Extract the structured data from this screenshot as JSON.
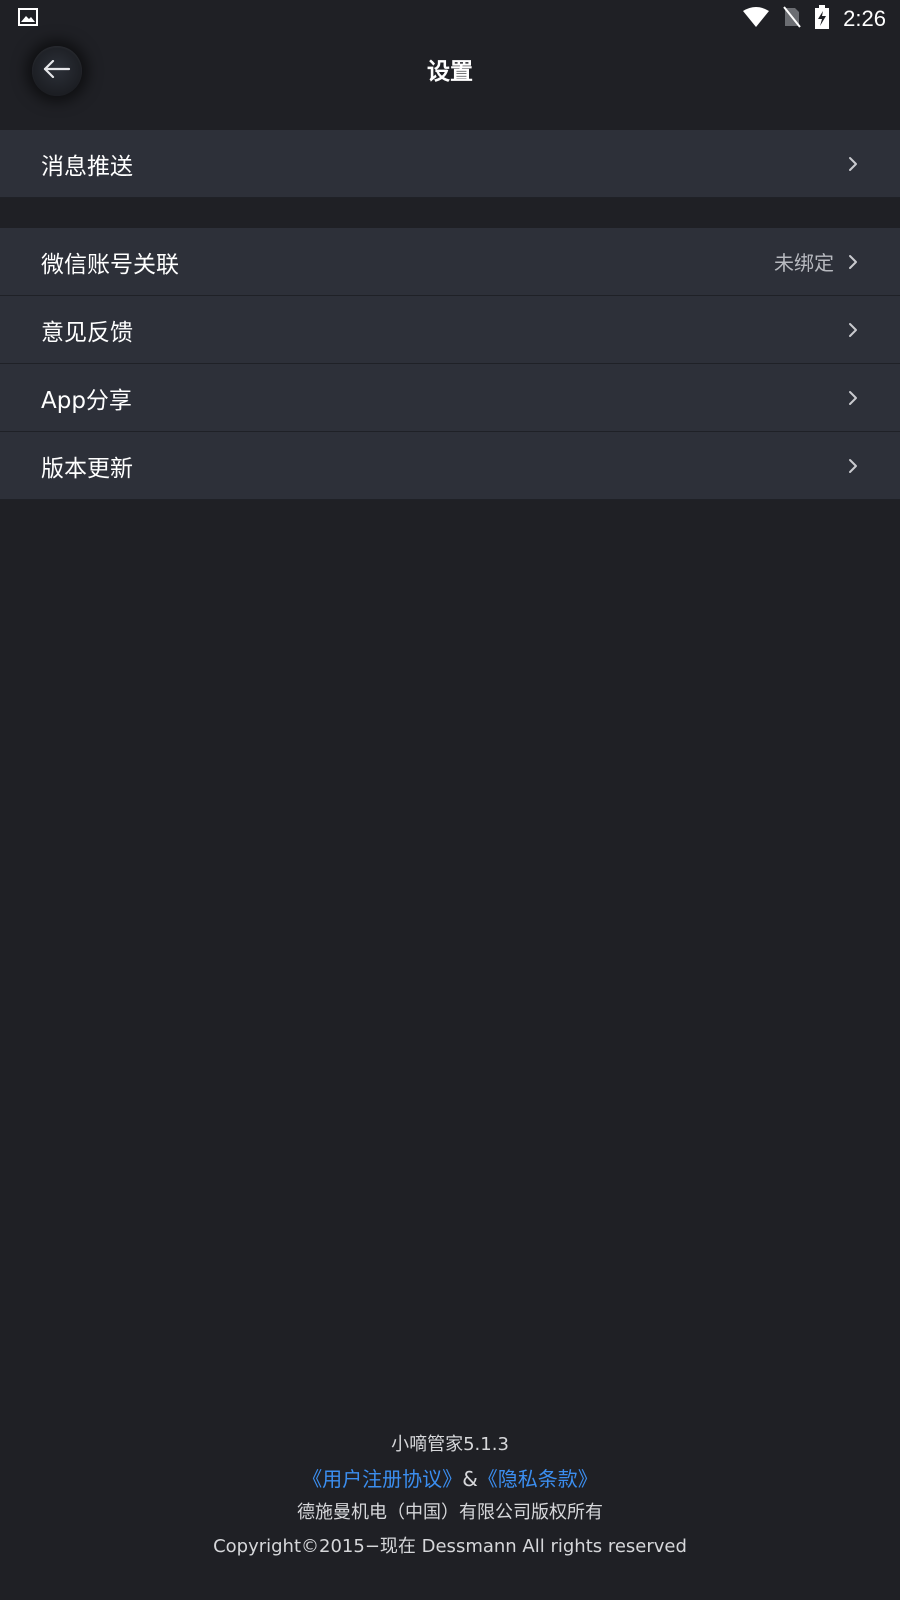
{
  "status_bar": {
    "time": "2:26",
    "icons": [
      "image-notification-icon",
      "wifi-icon",
      "no-sim-icon",
      "battery-charging-icon"
    ]
  },
  "header": {
    "title": "设置",
    "back_icon": "arrow-left-icon"
  },
  "groups": [
    {
      "items": [
        {
          "label": "消息推送",
          "value": ""
        }
      ]
    },
    {
      "items": [
        {
          "label": "微信账号关联",
          "value": "未绑定"
        },
        {
          "label": "意见反馈",
          "value": ""
        },
        {
          "label": "App分享",
          "value": ""
        },
        {
          "label": "版本更新",
          "value": ""
        }
      ]
    }
  ],
  "footer": {
    "app_version": "小嘀管家5.1.3",
    "user_agreement_link": "《用户注册协议》",
    "separator": "&",
    "privacy_link": "《隐私条款》",
    "company": "德施曼机电（中国）有限公司版权所有",
    "copyright": "Copyright©2015−现在 Dessmann All rights reserved"
  },
  "colors": {
    "background": "#1f2025",
    "row_background": "#2d3039",
    "link": "#3b8ef0"
  }
}
